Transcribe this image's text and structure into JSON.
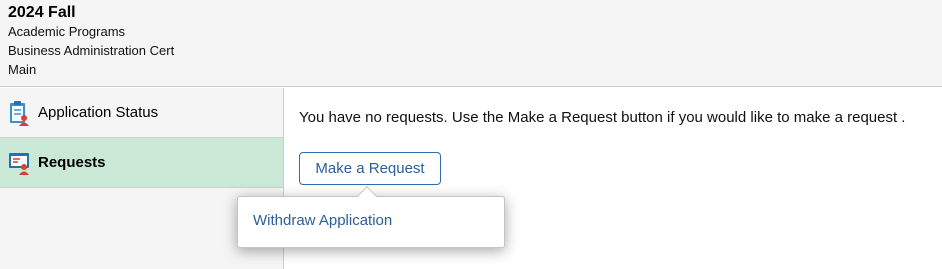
{
  "header": {
    "term": "2024 Fall",
    "program": "Academic Programs",
    "plan": "Business Administration Cert",
    "campus": "Main"
  },
  "sidebar": {
    "items": [
      {
        "label": "Application Status",
        "icon": "application-status-icon",
        "active": false
      },
      {
        "label": "Requests",
        "icon": "requests-icon",
        "active": true
      }
    ]
  },
  "main": {
    "message": "You have no requests. Use the Make a Request button if you would like to make a request .",
    "make_request_label": "Make a Request"
  },
  "popup": {
    "items": [
      {
        "label": "Withdraw Application"
      }
    ]
  },
  "colors": {
    "active_sidebar": "#c9e8d6",
    "link_blue": "#2b5f99",
    "header_bg": "#f5f5f5"
  }
}
